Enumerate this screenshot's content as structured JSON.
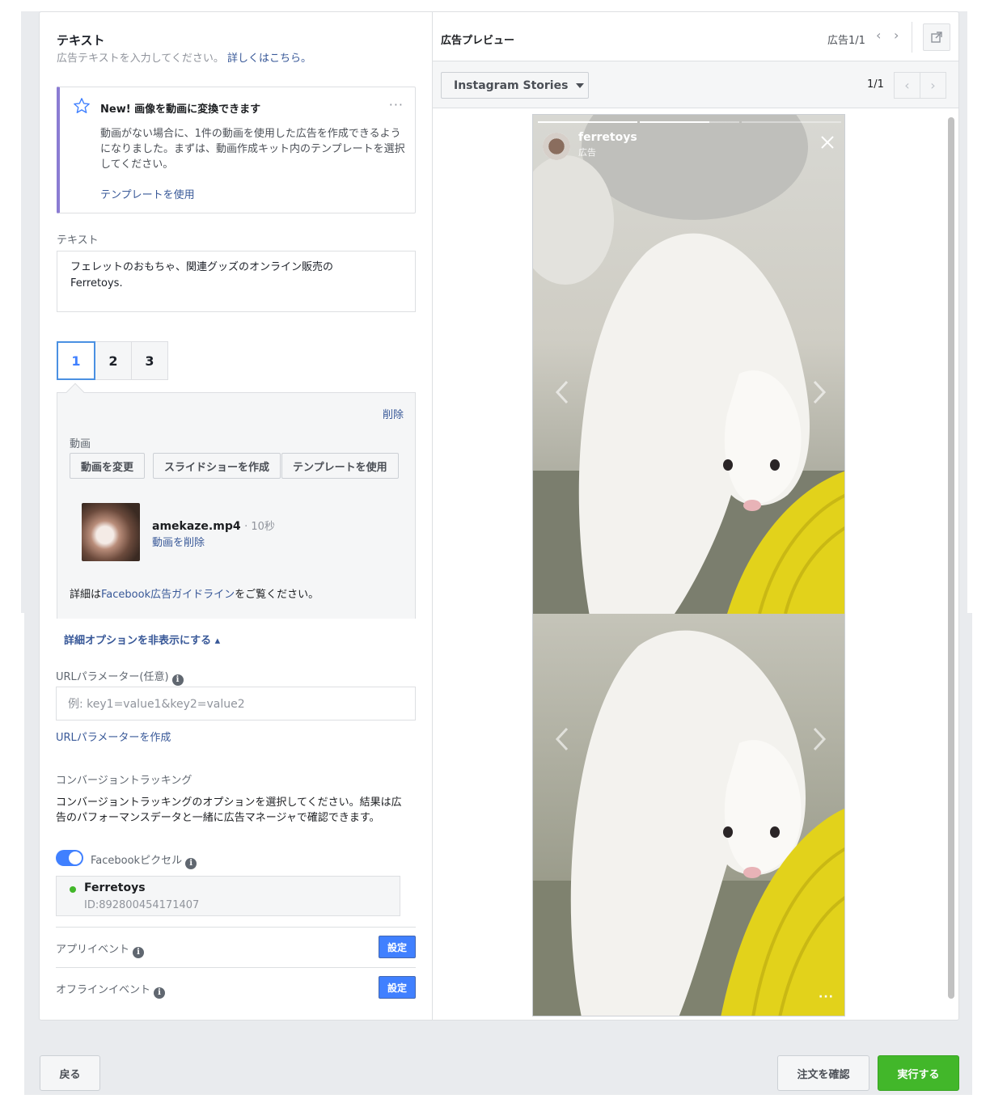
{
  "text_section": {
    "title": "テキスト",
    "subtitle": "広告テキストを入力してください。",
    "learn_more": "詳しくはこちら。"
  },
  "notice": {
    "title": "New! 画像を動画に変換できます",
    "more": "···",
    "body": "動画がない場合に、1件の動画を使用した広告を作成できるようになりました。まずは、動画作成キット内のテンプレートを選択してください。",
    "link": "テンプレートを使用"
  },
  "text_field": {
    "label": "テキスト",
    "line1": "フェレットのおもちゃ、関連グッズのオンライン販売の",
    "line2": "Ferretoys."
  },
  "card_tabs": [
    "1",
    "2",
    "3"
  ],
  "card_panel": {
    "delete": "削除",
    "video_label": "動画",
    "buttons": [
      "動画を変更",
      "スライドショーを作成",
      "テンプレートを使用"
    ],
    "file_name": "amekaze.mp4",
    "duration": "· 10秒",
    "remove_video": "動画を削除",
    "guideline_prefix": "詳細は",
    "guideline_link": "Facebook広告ガイドライン",
    "guideline_suffix": "をご覧ください。"
  },
  "advanced": {
    "toggle": "詳細オプションを非表示にする ▴",
    "url_label": "URLパラメーター(任意)",
    "url_placeholder": "例: key1=value1&key2=value2",
    "url_builder": "URLパラメーターを作成"
  },
  "conversion": {
    "title": "コンバージョントラッキング",
    "desc_line1": "コンバージョントラッキングのオプションを選択してください。結果は広",
    "desc_line2": "告のパフォーマンスデータと一緒に広告マネージャで確認できます。",
    "pixel_label": "Facebookピクセル",
    "pixel_name": "Ferretoys",
    "pixel_id": "ID:892800454171407",
    "app_events": "アプリイベント",
    "offline_events": "オフラインイベント",
    "setup": "設定"
  },
  "preview": {
    "title": "広告プレビュー",
    "ad_count": "広告1/1",
    "placement": "Instagram Stories",
    "page": "1/1",
    "account": "ferretoys",
    "sponsored": "広告"
  },
  "footer": {
    "back": "戻る",
    "review": "注文を確認",
    "publish": "実行する"
  },
  "colors": {
    "accent": "#4080ff",
    "link": "#385898",
    "publish_green": "#42b72a",
    "notice_bar": "#8b7cd3"
  }
}
